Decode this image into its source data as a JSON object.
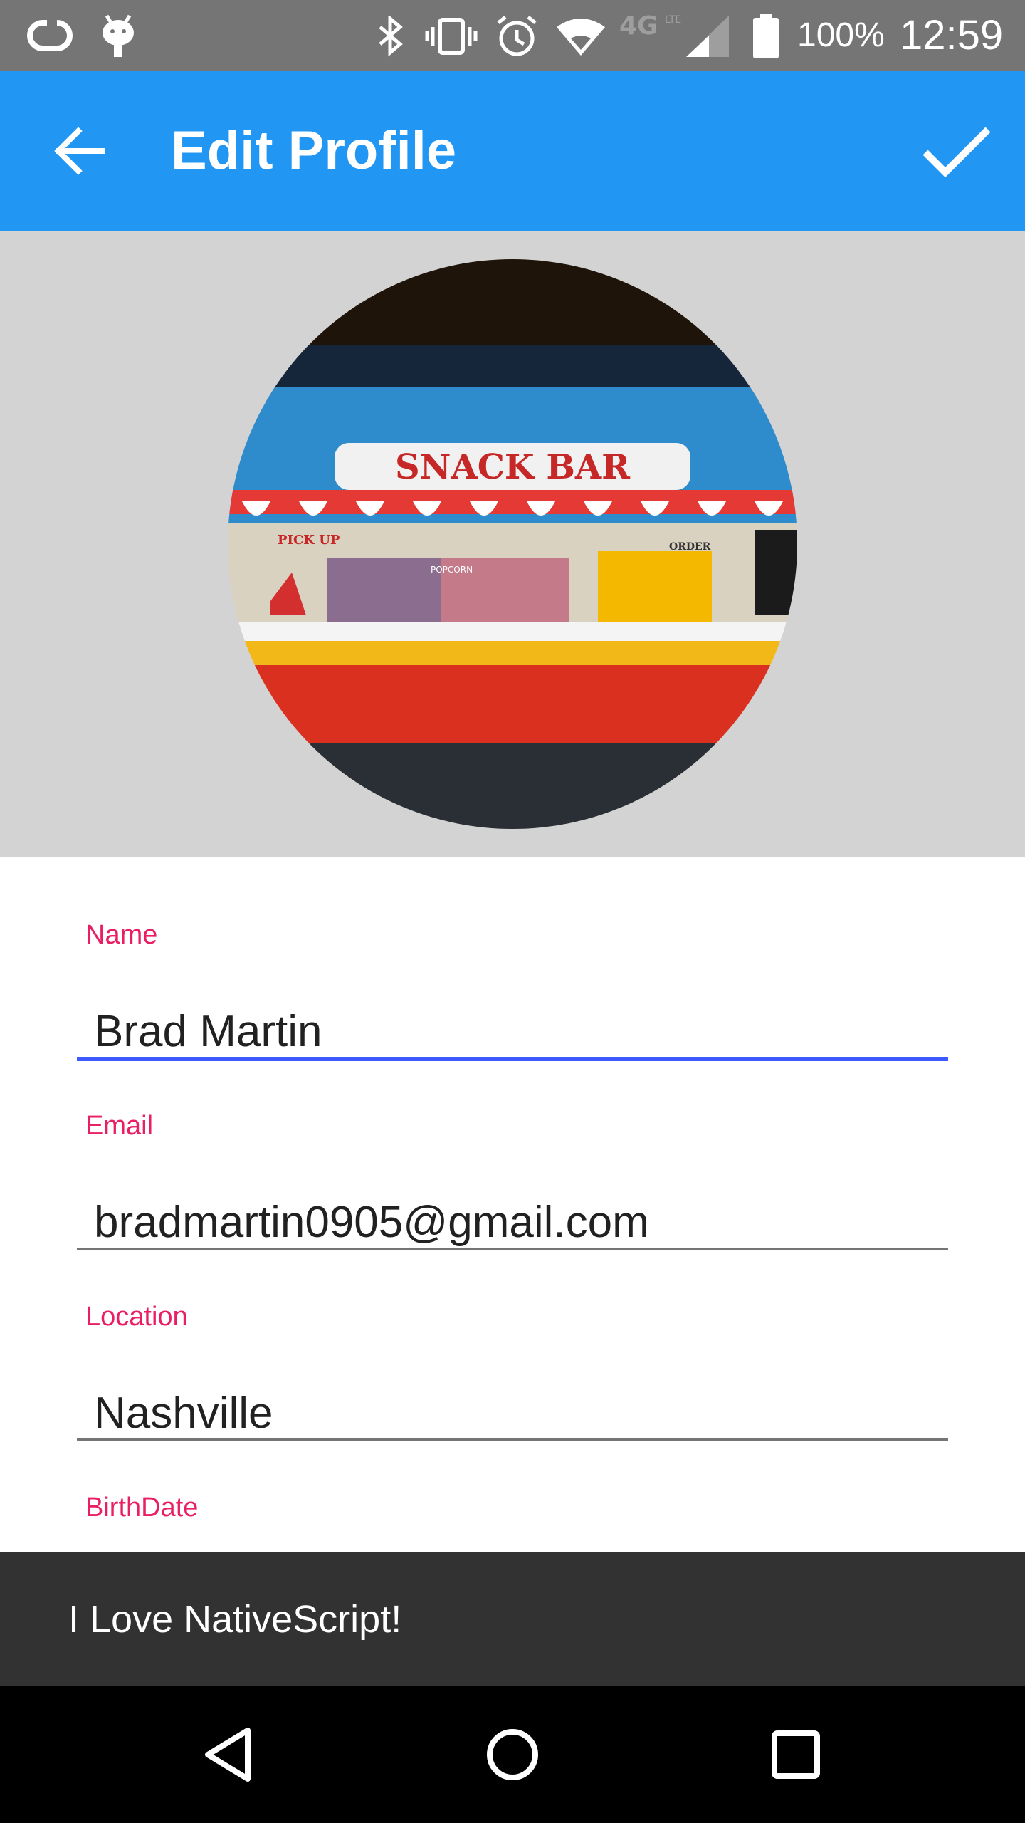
{
  "status_bar": {
    "battery_percent": "100%",
    "time": "12:59",
    "network": "4G LTE",
    "icons": [
      "sync-icon",
      "android-debug-icon",
      "bluetooth-icon",
      "vibrate-icon",
      "alarm-icon",
      "wifi-icon",
      "lte-icon",
      "cell-signal-icon",
      "battery-icon"
    ]
  },
  "app_bar": {
    "title": "Edit Profile",
    "back_icon": "arrow-back-icon",
    "confirm_icon": "check-icon",
    "background": "#2196F3"
  },
  "profile_photo": {
    "sign_text": "SNACK BAR",
    "pickup_text": "PICK UP",
    "order_text": "ORDER",
    "popcorn_text": "POPCORN"
  },
  "form": {
    "name": {
      "label": "Name",
      "value": "Brad Martin",
      "focused": true
    },
    "email": {
      "label": "Email",
      "value": "bradmartin0905@gmail.com"
    },
    "location": {
      "label": "Location",
      "value": "Nashville"
    },
    "birthdate": {
      "label": "BirthDate",
      "value": ""
    },
    "label_color": "#E91E63",
    "focus_color": "#3D5AFE"
  },
  "snackbar": {
    "message": "I Love NativeScript!"
  },
  "nav_bar": {
    "icons": [
      "nav-back-icon",
      "nav-home-icon",
      "nav-recents-icon"
    ]
  }
}
